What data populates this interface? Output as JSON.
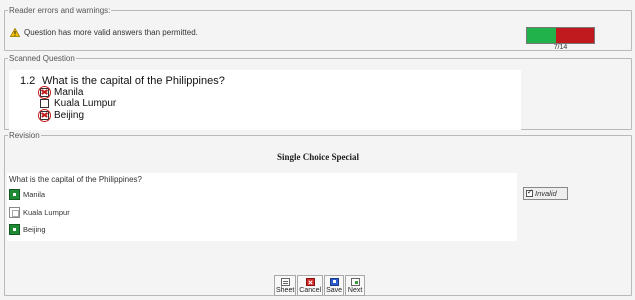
{
  "reader_errors": {
    "legend": "Reader errors and warnings:",
    "warning_icon": "warning-triangle-icon",
    "warning_text": "Question has more valid answers than permitted.",
    "progress": {
      "label": "7/14",
      "current": 7,
      "total": 14,
      "fill_fraction": 0.44,
      "fill_color": "#22b24c",
      "rest_color": "#c01a1e"
    }
  },
  "scanned": {
    "legend": "Scanned Question",
    "number": "1.2",
    "question": "What is the capital of the Philippines?",
    "options": [
      {
        "label": "Manila",
        "marked": true
      },
      {
        "label": "Kuala Lumpur",
        "marked": false
      },
      {
        "label": "Beijing",
        "marked": true
      }
    ]
  },
  "revision": {
    "legend": "Revision",
    "title": "Single Choice Special",
    "question": "What is the capital of the Philippines?",
    "options": [
      {
        "label": "Manila",
        "checked": true
      },
      {
        "label": "Kuala Lumpur",
        "checked": false
      },
      {
        "label": "Beijing",
        "checked": true
      }
    ],
    "invalid": {
      "label": "Invalid",
      "checked": true
    }
  },
  "toolbar": {
    "sheet_label": "Sheet",
    "cancel_label": "Cancel",
    "save_label": "Save",
    "next_label": "Next"
  },
  "colors": {
    "selected_green": "#1e8a34",
    "scan_mark_red": "#c41b1b"
  }
}
